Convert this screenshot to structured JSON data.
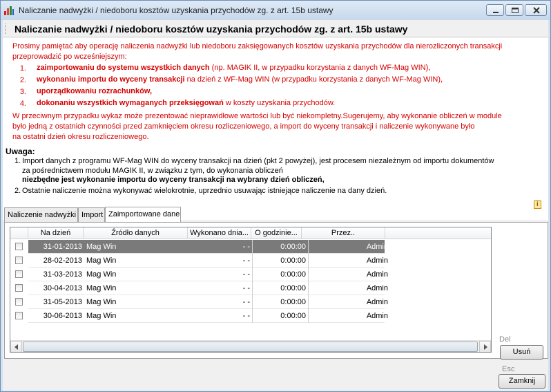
{
  "window": {
    "title": "Naliczanie nadwyżki / niedoboru kosztów uzyskania przychodów zg. z art. 15b ustawy"
  },
  "header": {
    "title": "Naliczanie nadwyżki / niedoboru kosztów uzyskania przychodów zg. z art. 15b ustawy"
  },
  "info": {
    "intro_1": "Prosimy pamiętać aby operację naliczenia nadwyżki lub niedoboru zaksięgowanych kosztów uzyskania przychodów dla nierozliczonych transakcji",
    "intro_2": "przeprowadzić po wcześniejszym:",
    "steps": [
      {
        "num": "1.",
        "bold": "zaimportowaniu do systemu wszystkich danych",
        "rest": " (np. MAGIK II, w przypadku korzystania z danych WF-Mag WIN),"
      },
      {
        "num": "2.",
        "bold": "wykonaniu importu do wyceny transakcji",
        "rest": " na dzień z WF-Mag WIN (w przypadku korzystania z danych WF-Mag WIN),"
      },
      {
        "num": "3.",
        "bold": "uporządkowaniu rozrachunków,",
        "rest": ""
      },
      {
        "num": "4.",
        "bold": "dokonaniu wszystkich wymaganych przeksięgowań",
        "rest": "  w koszty uzyskania przychodów."
      }
    ],
    "warn_1": "W przeciwnym przypadku wykaz może prezentować nieprawidłowe wartości lub być niekompletny.Sugerujemy, aby wykonanie obliczeń w module",
    "warn_2": "było jedną z ostatnich czynności przed zamknięciem okresu rozliczeniowego, a import do wyceny transakcji i naliczenie wykonywane było",
    "warn_3": "na ostatni dzień okresu rozliczeniowego.",
    "uwaga_title": "Uwaga:",
    "note1_num": "1.",
    "note1_l1": "Import danych z programu WF-Mag WIN do wyceny transakcji na dzień (pkt 2 powyżej), jest procesem niezależnym od importu dokumentów",
    "note1_l2": "za pośrednictwem modułu MAGIK II, w związku z tym, do wykonania obliczeń",
    "note1_l3": "niezbędne jest wykonanie importu do wyceny transakcji na wybrany dzień obliczeń,",
    "note2_num": "2.",
    "note2": "Ostatnie naliczenie można wykonywać wielokrotnie, uprzednio usuwając istniejące naliczenie na dany dzień.",
    "icon": "info-icon"
  },
  "tabs": [
    {
      "label": "Naliczenie nadwyżki",
      "active": false
    },
    {
      "label": "Import",
      "active": false
    },
    {
      "label": "Zaimportowane dane",
      "active": true
    }
  ],
  "grid": {
    "columns": [
      "Na dzień",
      "Źródło danych",
      "Wykonano dnia...",
      "O godzinie...",
      "Przez.."
    ],
    "rows": [
      {
        "date": "31-01-2013",
        "source": "Mag Win",
        "done_on": "- -",
        "time": "0:00:00",
        "by": "Admin",
        "selected": true
      },
      {
        "date": "28-02-2013",
        "source": "Mag Win",
        "done_on": "- -",
        "time": "0:00:00",
        "by": "Admin",
        "selected": false
      },
      {
        "date": "31-03-2013",
        "source": "Mag Win",
        "done_on": "- -",
        "time": "0:00:00",
        "by": "Admin",
        "selected": false
      },
      {
        "date": "30-04-2013",
        "source": "Mag Win",
        "done_on": "- -",
        "time": "0:00:00",
        "by": "Admin",
        "selected": false
      },
      {
        "date": "31-05-2013",
        "source": "Mag Win",
        "done_on": "- -",
        "time": "0:00:00",
        "by": "Admin",
        "selected": false
      },
      {
        "date": "30-06-2013",
        "source": "Mag Win",
        "done_on": "- -",
        "time": "0:00:00",
        "by": "Admin",
        "selected": false
      }
    ]
  },
  "buttons": {
    "delete_hint": "Del",
    "delete_label": "Usuń",
    "close_hint": "Esc",
    "close_label": "Zamknij"
  },
  "colors": {
    "warning_text": "#d40000",
    "selected_row": "#7a7a7a"
  }
}
